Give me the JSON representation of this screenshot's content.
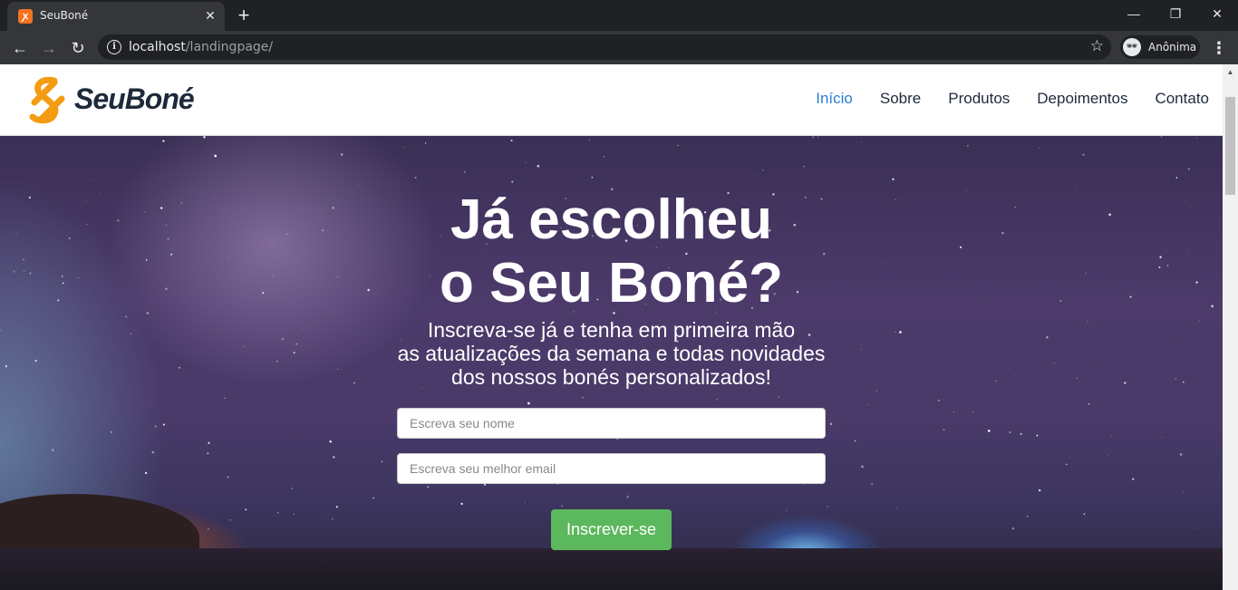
{
  "browser": {
    "tab_title": "SeuBoné",
    "url_host": "localhost",
    "url_path": "/landingpage/",
    "profile_label": "Anônima"
  },
  "site": {
    "logo_text": "SeuBoné",
    "nav": [
      "Início",
      "Sobre",
      "Produtos",
      "Depoimentos",
      "Contato"
    ],
    "active_nav": "Início",
    "accent_color": "#2d7fd3"
  },
  "hero": {
    "title_line1": "Já escolheu",
    "title_line2": "o Seu Boné?",
    "subtitle_line1": "Inscreva-se já e tenha em primeira mão",
    "subtitle_line2": "as atualizações da semana e todas novidades",
    "subtitle_line3": "dos nossos bonés personalizados!",
    "name_placeholder": "Escreva seu nome",
    "email_placeholder": "Escreva seu melhor email",
    "submit_label": "Inscrever-se",
    "submit_color": "#5cb85c"
  }
}
